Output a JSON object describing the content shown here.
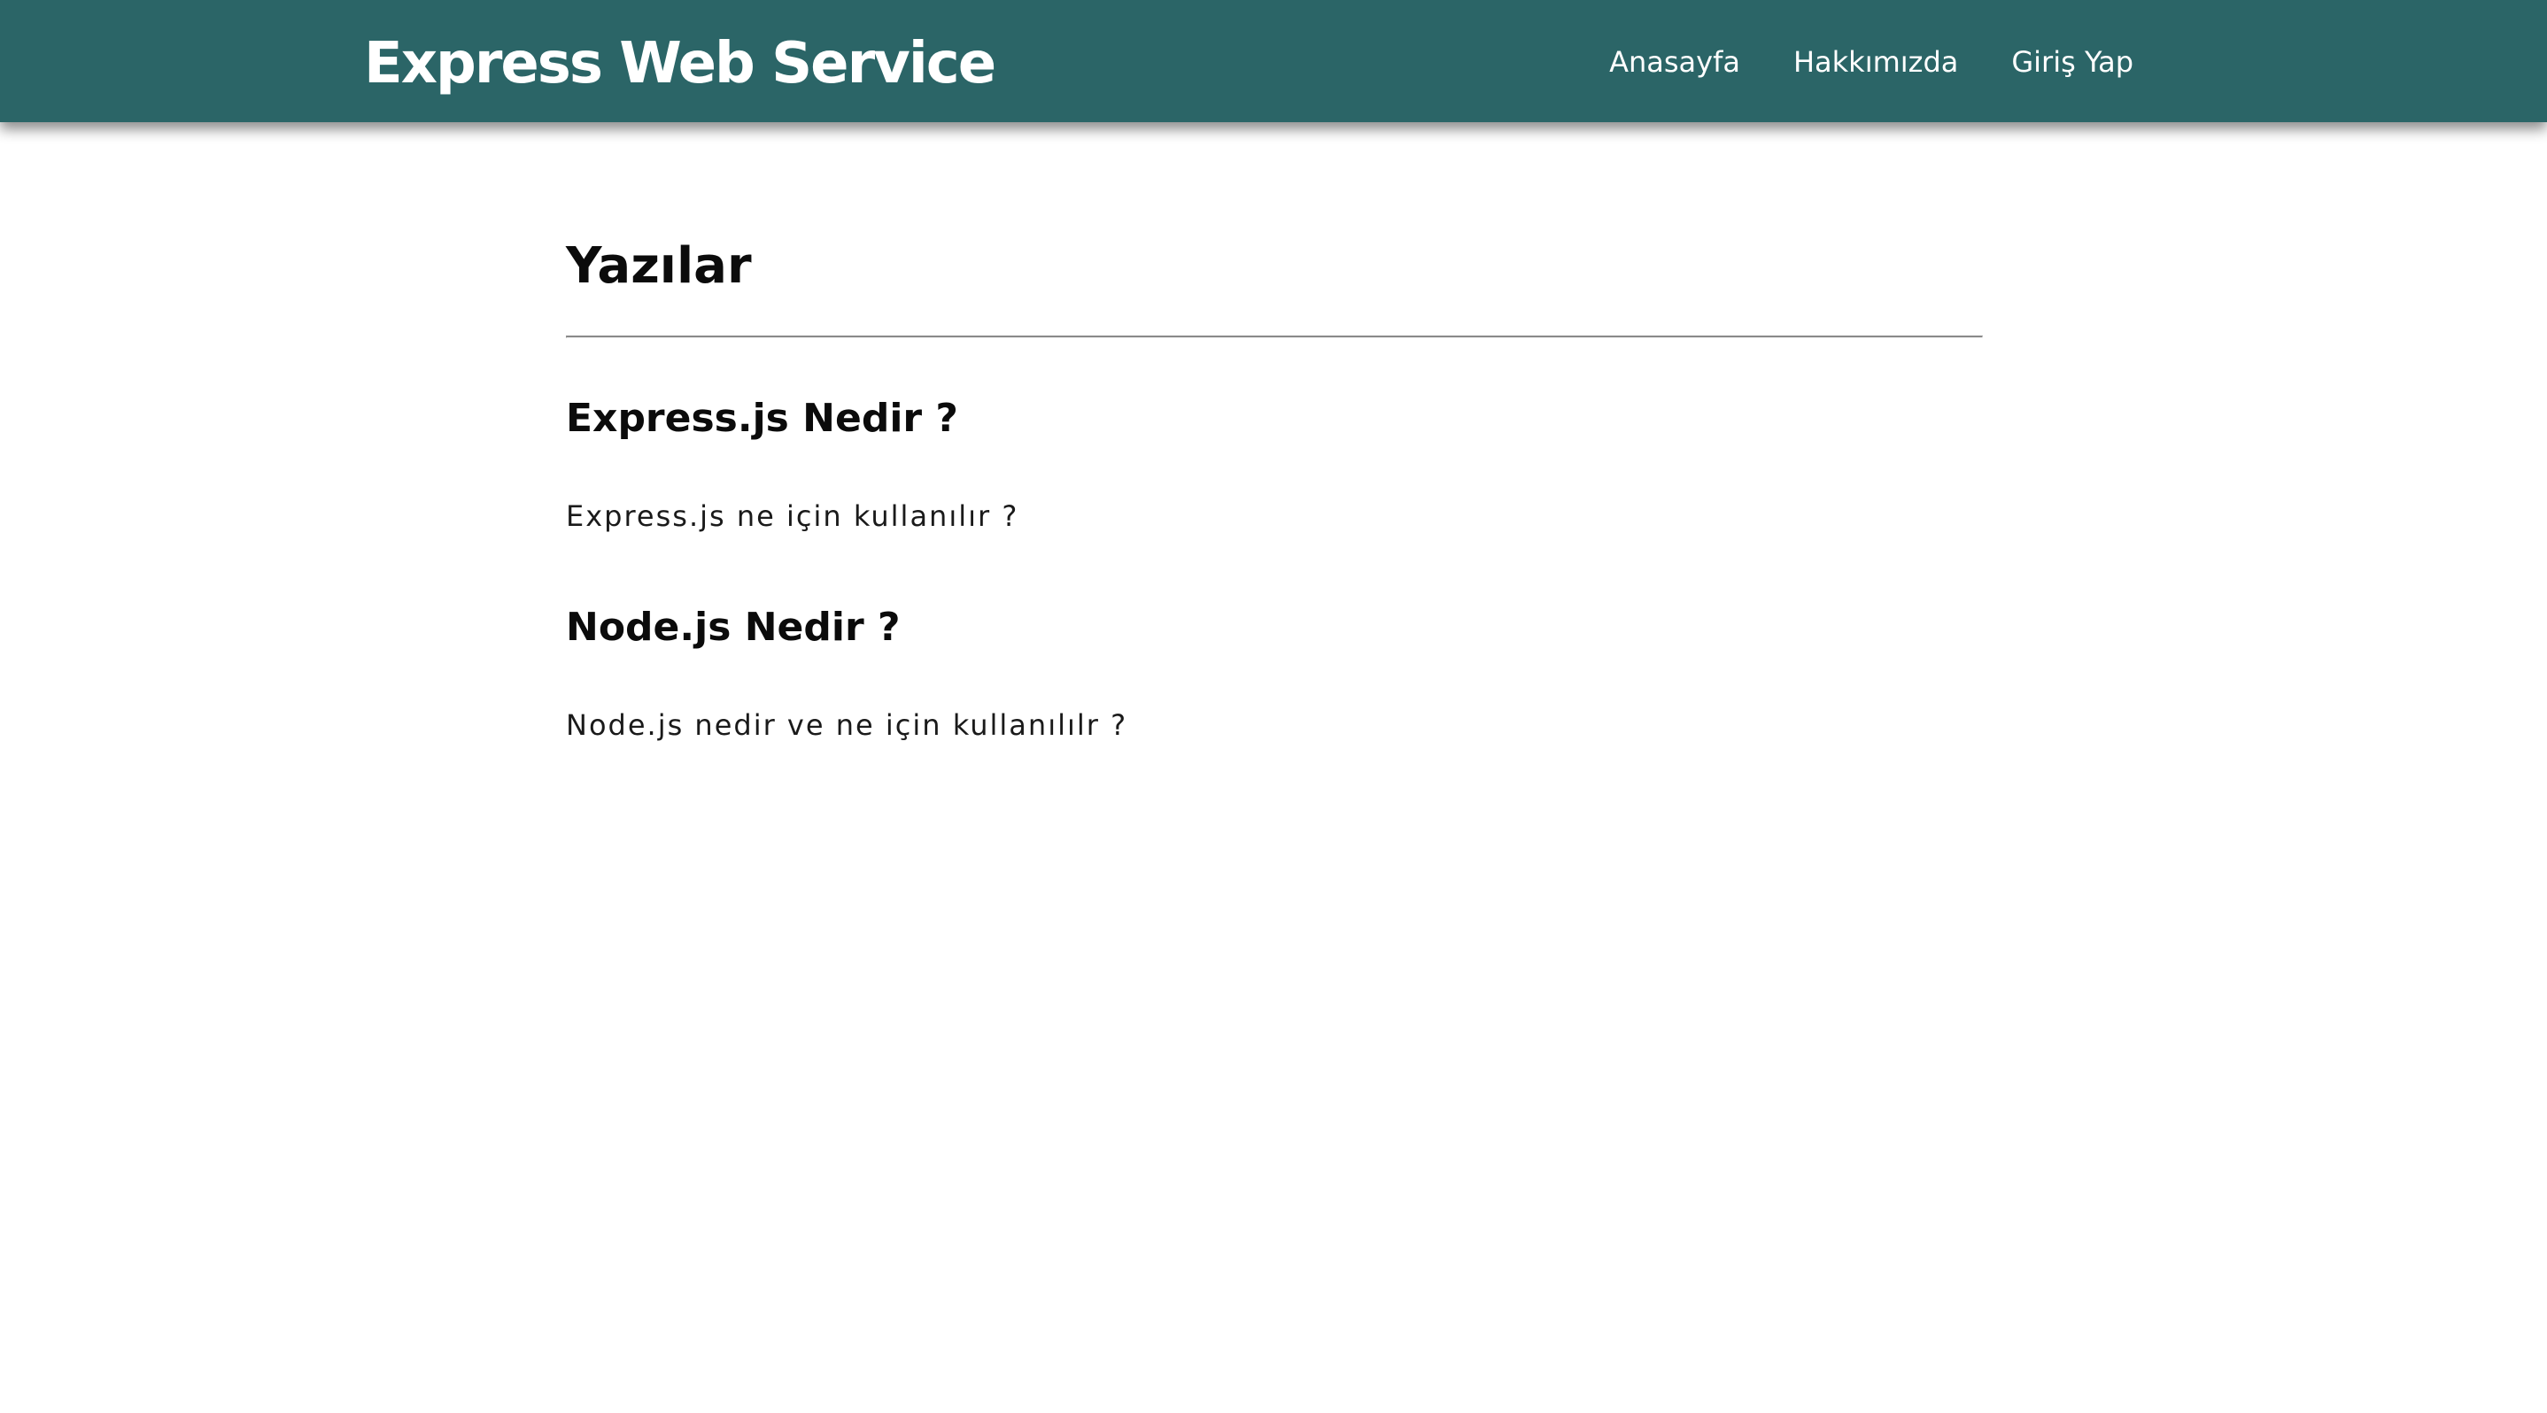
{
  "header": {
    "brand": "Express Web Service",
    "nav": [
      {
        "label": "Anasayfa"
      },
      {
        "label": "Hakkımızda"
      },
      {
        "label": "Giriş Yap"
      }
    ],
    "background_color": "#2b6567"
  },
  "main": {
    "title": "Yazılar",
    "posts": [
      {
        "title": "Express.js Nedir ?",
        "description": "Express.js ne için kullanılır ?"
      },
      {
        "title": "Node.js Nedir ?",
        "description": "Node.js nedir ve ne için kullanılılr ?"
      }
    ]
  }
}
